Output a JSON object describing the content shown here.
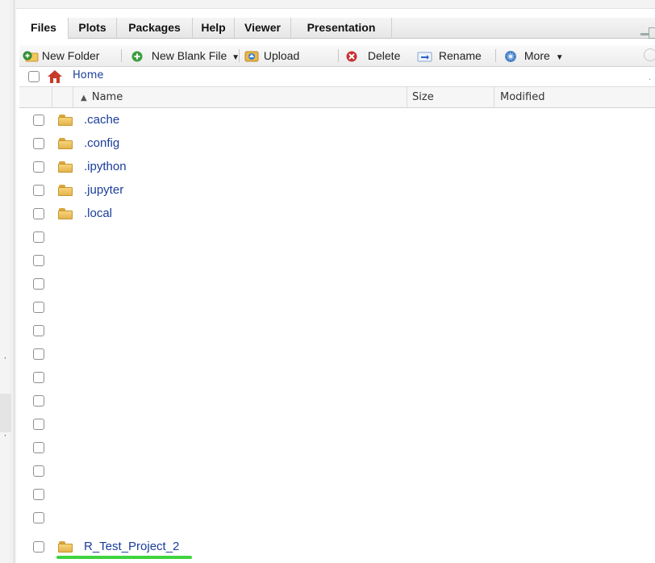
{
  "tabs": [
    {
      "label": "Files",
      "active": true
    },
    {
      "label": "Plots",
      "active": false
    },
    {
      "label": "Packages",
      "active": false
    },
    {
      "label": "Help",
      "active": false
    },
    {
      "label": "Viewer",
      "active": false
    },
    {
      "label": "Presentation",
      "active": false
    }
  ],
  "toolbar": {
    "new_folder": "New Folder",
    "new_blank_file": "New Blank File",
    "upload": "Upload",
    "delete": "Delete",
    "rename": "Rename",
    "more": "More"
  },
  "breadcrumb": {
    "home": "Home"
  },
  "columns": {
    "name": "Name",
    "size": "Size",
    "modified": "Modified",
    "sort_indicator": "▲"
  },
  "files": [
    ".cache",
    ".config",
    ".ipython",
    ".jupyter",
    ".local"
  ],
  "empty_rows": 13,
  "highlighted_file": "R_Test_Project_2",
  "colors": {
    "link": "#1a3d9a",
    "highlight_underline": "#3fd43f",
    "folder": "#f7d47a"
  }
}
